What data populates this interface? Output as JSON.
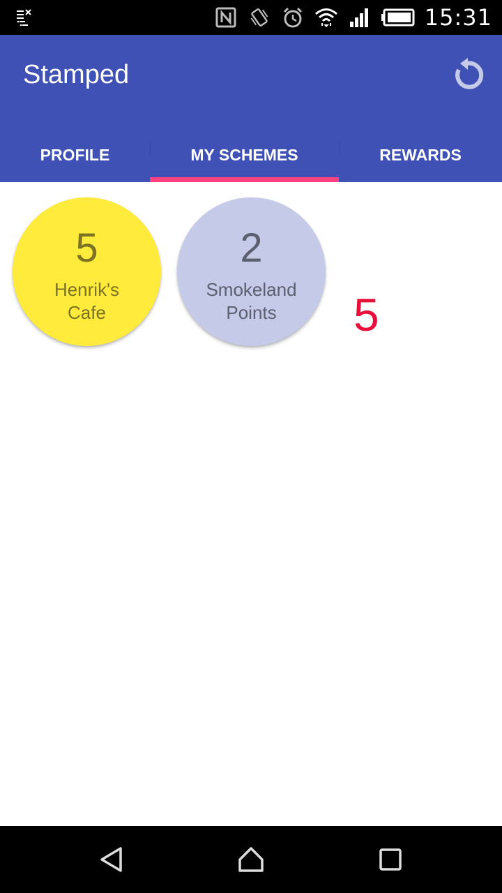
{
  "status_bar": {
    "time": "15:31",
    "icons": [
      "notification-clear-icon",
      "nfc-icon",
      "vibrate-icon",
      "alarm-icon",
      "wifi-icon",
      "signal-icon",
      "battery-icon"
    ]
  },
  "app_bar": {
    "title": "Stamped",
    "refresh_icon": "refresh-icon",
    "color": "#3F51B5"
  },
  "tabs": [
    {
      "label": "PROFILE",
      "selected": false
    },
    {
      "label": "MY SCHEMES",
      "selected": true
    },
    {
      "label": "REWARDS",
      "selected": false
    }
  ],
  "tab_indicator_color": "#FF4081",
  "schemes": [
    {
      "count": "5",
      "name_line1": "Henrik's",
      "name_line2": "Cafe",
      "color": "#FFEB3B"
    },
    {
      "count": "2",
      "name_line1": "Smokeland",
      "name_line2": "Points",
      "color": "#C5CAE9"
    }
  ],
  "red_count": "5",
  "nav_bar": {
    "icons": [
      "back-icon",
      "home-icon",
      "recent-apps-icon"
    ]
  }
}
